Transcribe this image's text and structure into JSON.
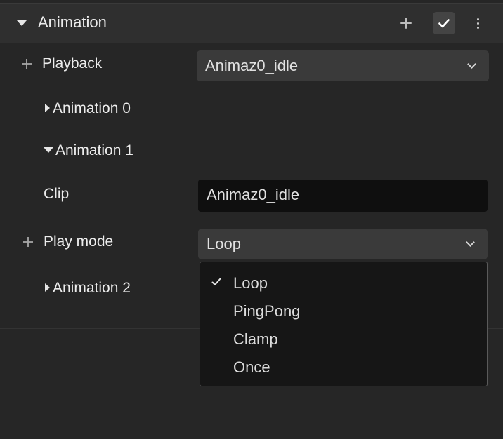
{
  "header": {
    "title": "Animation",
    "add_icon": "plus-icon",
    "confirm_icon": "check-icon",
    "more_icon": "more-vertical-icon"
  },
  "playback": {
    "label": "Playback",
    "value": "Animaz0_idle"
  },
  "animations": [
    {
      "label": "Animation 0",
      "expanded": false
    },
    {
      "label": "Animation 1",
      "expanded": true
    },
    {
      "label": "Animation 2",
      "expanded": false
    }
  ],
  "clip": {
    "label": "Clip",
    "value": "Animaz0_idle"
  },
  "play_mode": {
    "label": "Play mode",
    "value": "Loop",
    "options": [
      "Loop",
      "PingPong",
      "Clamp",
      "Once"
    ],
    "selected_index": 0
  },
  "colors": {
    "background": "#262626",
    "header": "#2f2f2f",
    "select": "#3a3a3a",
    "textfield": "#0f0f0f",
    "dropdown": "#161616"
  }
}
